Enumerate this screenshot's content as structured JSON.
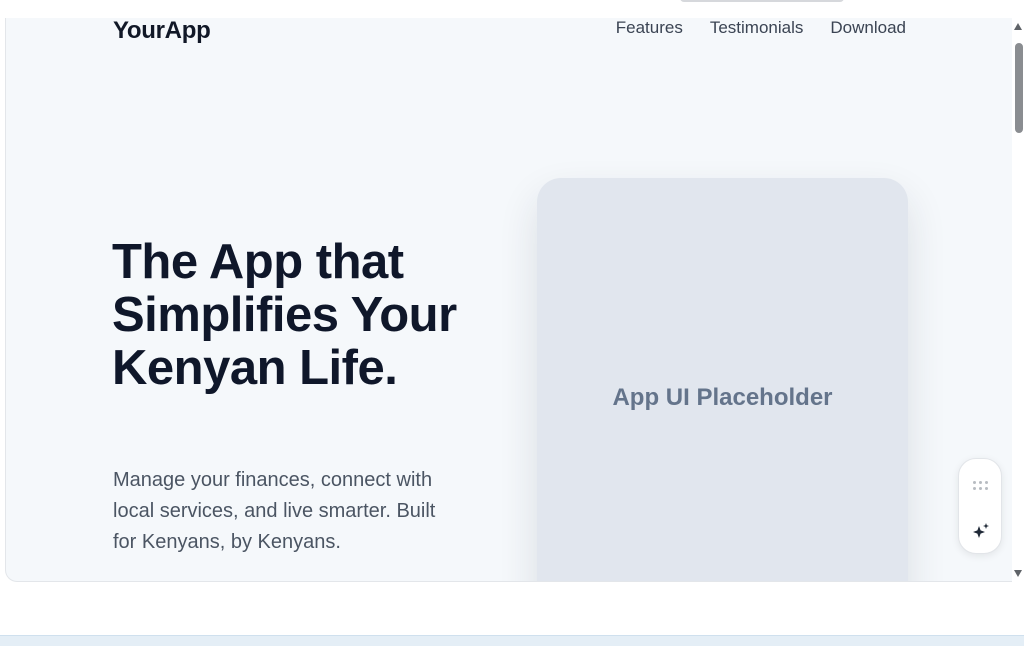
{
  "header": {
    "brand": "YourApp",
    "nav": [
      "Features",
      "Testimonials",
      "Download"
    ]
  },
  "hero": {
    "title": "The App that Simplifies Your Kenyan Life.",
    "subtitle": "Manage your finances, connect with local services, and live smarter. Built for Kenyans, by Kenyans."
  },
  "placeholder": {
    "label": "App UI Placeholder"
  },
  "widget": {
    "icons": [
      "grip-dots-icon",
      "sparkle-icon"
    ]
  },
  "colors": {
    "background": "#f5f8fb",
    "text_primary": "#0f172a",
    "text_secondary": "#4b5563",
    "card": "#e1e6ee",
    "placeholder_text": "#64748b"
  }
}
